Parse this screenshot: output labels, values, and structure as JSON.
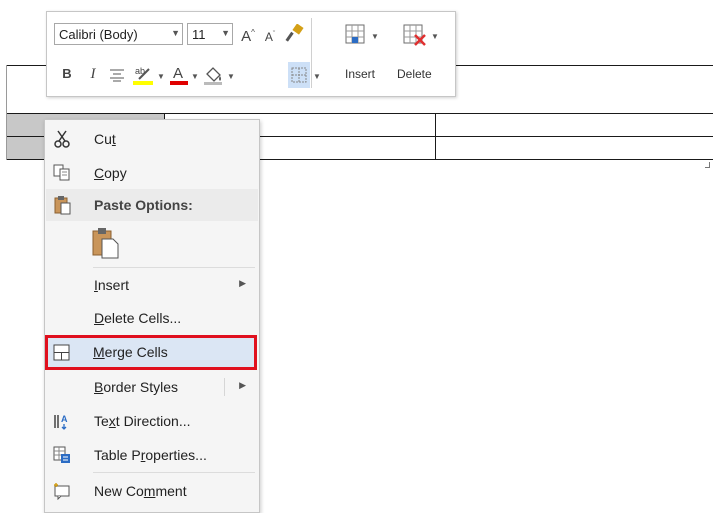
{
  "toolbar": {
    "font_name": "Calibri (Body)",
    "font_size": "11",
    "insert_label": "Insert",
    "delete_label": "Delete",
    "icons": [
      "grow-font-icon",
      "shrink-font-icon",
      "format-painter-icon",
      "insert-table-icon",
      "delete-table-icon",
      "bold-icon",
      "italic-icon",
      "center-align-icon",
      "highlight-icon",
      "font-color-icon",
      "shading-icon",
      "borders-icon"
    ],
    "colors": {
      "highlight": "#ffff00",
      "font_color": "#e00000",
      "accent": "#2b579a"
    }
  },
  "context_menu": {
    "items": [
      {
        "id": "cut",
        "pre": "Cu",
        "ul": "t",
        "post": "",
        "icon": "scissors-icon"
      },
      {
        "id": "copy",
        "pre": "",
        "ul": "C",
        "post": "opy",
        "icon": "copy-icon"
      },
      {
        "id": "paste_options",
        "label": "Paste Options:",
        "icon": "clipboard-icon"
      },
      {
        "id": "insert",
        "pre": "",
        "ul": "I",
        "post": "nsert",
        "has_submenu": true
      },
      {
        "id": "delete_cells",
        "pre": "",
        "ul": "D",
        "post": "elete Cells...",
        "icon": ""
      },
      {
        "id": "merge_cells",
        "pre": "",
        "ul": "M",
        "post": "erge Cells",
        "icon": "merge-cells-icon",
        "highlighted": true
      },
      {
        "id": "border_styles",
        "pre": "",
        "ul": "B",
        "post": "order Styles",
        "has_submenu": true
      },
      {
        "id": "text_direction",
        "pre": "Te",
        "ul": "x",
        "post": "t Direction...",
        "icon": "text-direction-icon"
      },
      {
        "id": "table_properties",
        "pre": "Table P",
        "ul": "r",
        "post": "operties...",
        "icon": "table-properties-icon"
      },
      {
        "id": "new_comment",
        "pre": "New Co",
        "ul": "m",
        "post": "ment",
        "icon": "new-comment-icon"
      }
    ],
    "highlight_border_color": "#e0101e"
  }
}
